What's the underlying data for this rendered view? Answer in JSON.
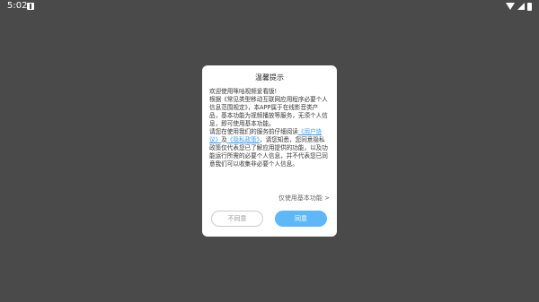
{
  "status_bar": {
    "time": "5:02"
  },
  "dialog": {
    "title": "温馨提示",
    "body": {
      "para1": "欢迎使用咪咕视频爱看版!",
      "para2": "根据《常见类型移动互联网应用程序必要个人信息范围规定》，本APP属于在线影音类产品，基本功能为视频播放等服务，无须个人信息，即可使用基本功能。",
      "para3_prefix": "请您在使用我们的服务前仔细阅读",
      "user_agreement_link": "《用户协议》",
      "para3_and": "及",
      "privacy_policy_link": "《隐私政策》",
      "para3_suffix": "，请您知悉，您同意隐私政策仅代表您已了解应用提供的功能，以及功能运行所需的必要个人信息，并不代表您已同意我们可以收集非必要个人信息。"
    },
    "basic_function_link": "仅使用基本功能 >",
    "disagree_label": "不同意",
    "agree_label": "同意"
  },
  "colors": {
    "backdrop": "#4a4a4a",
    "link": "#3a9df8",
    "agree_button": "#5eb8f7"
  },
  "icons": [
    "notification-icon",
    "wifi-icon",
    "signal-icon",
    "battery-icon"
  ]
}
